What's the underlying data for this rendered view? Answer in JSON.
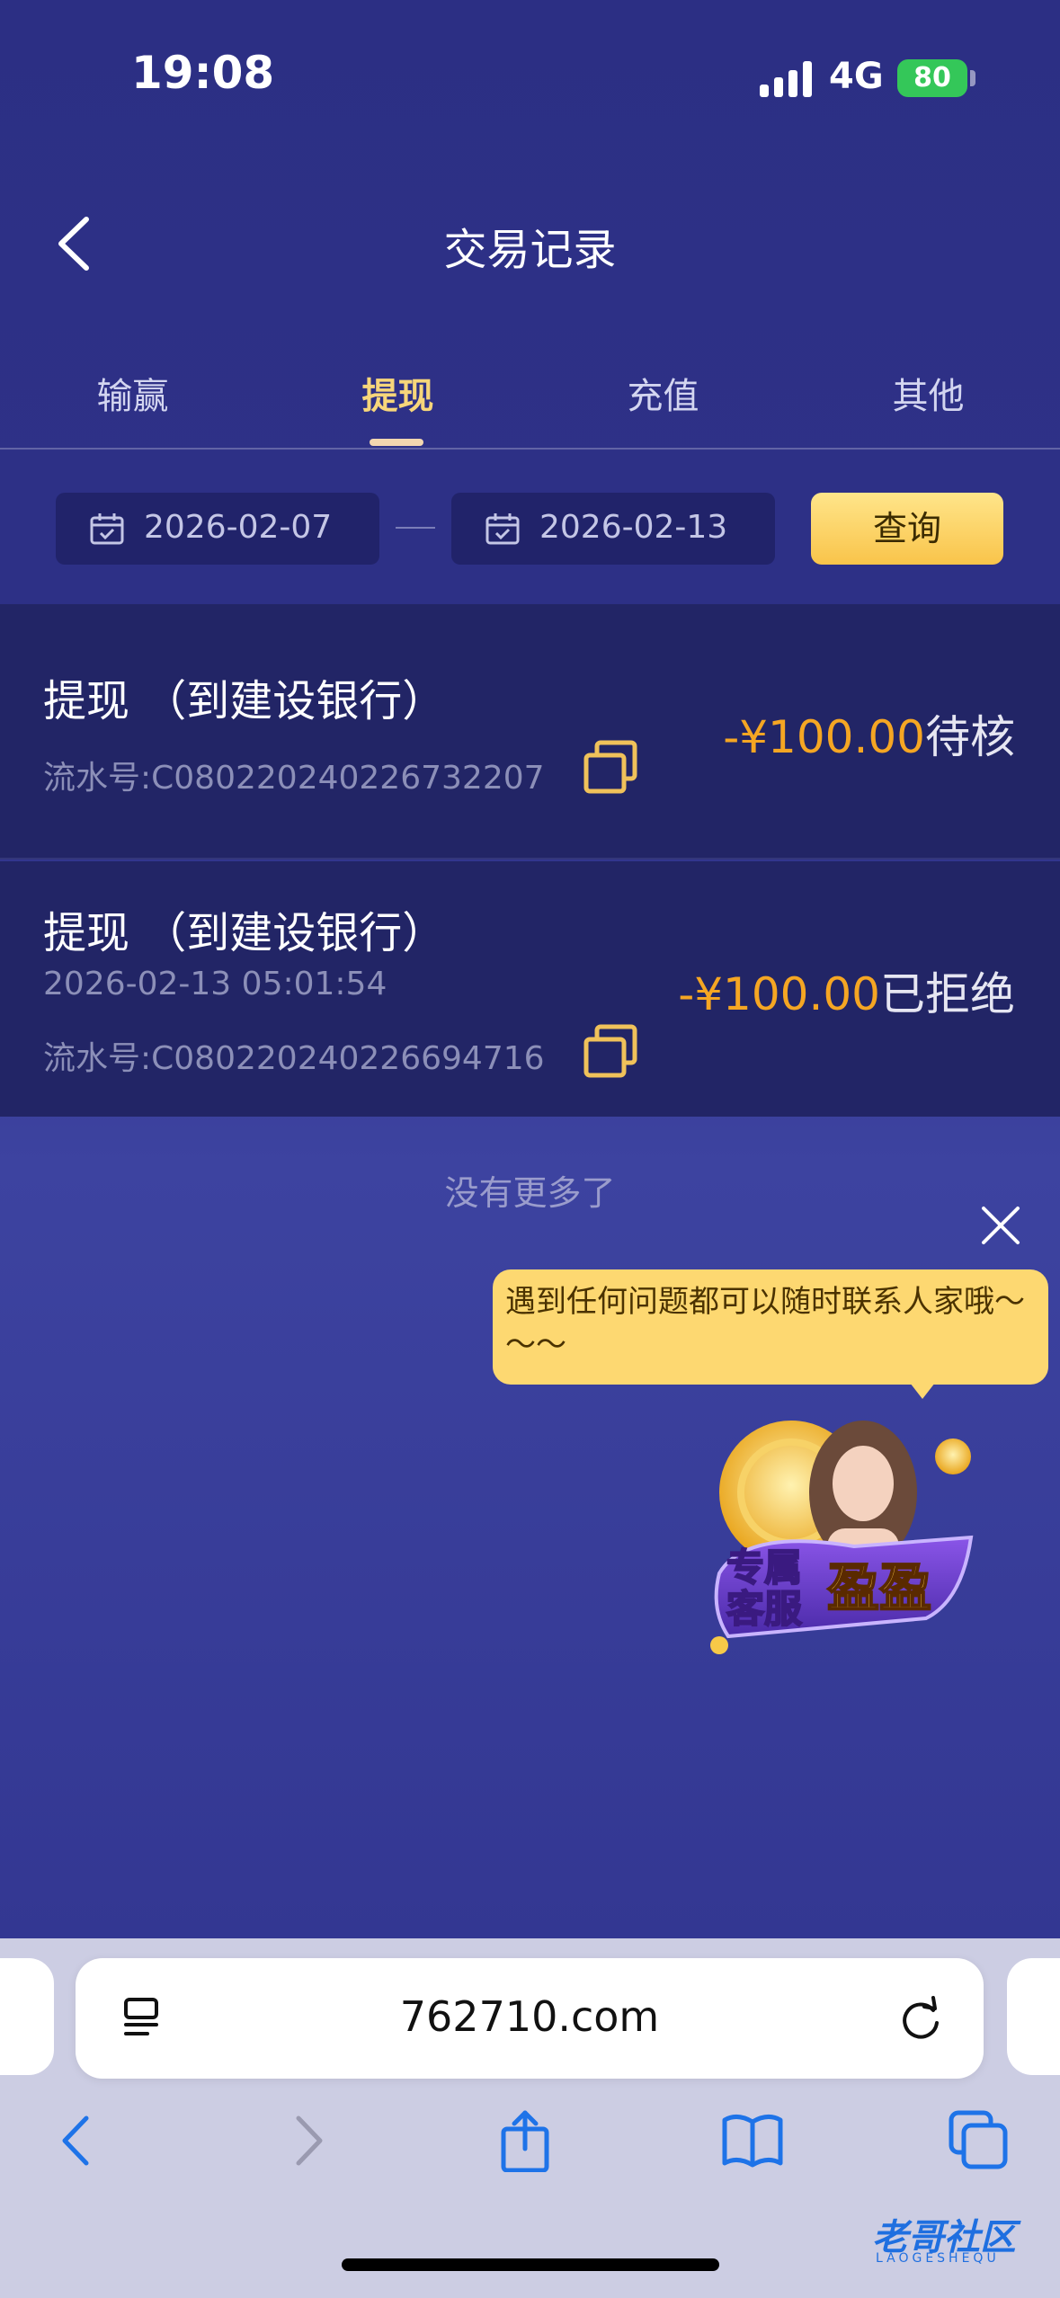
{
  "status_bar": {
    "time": "19:08",
    "network": "4G",
    "battery": "80"
  },
  "header": {
    "title": "交易记录"
  },
  "tabs": [
    {
      "label": "输赢"
    },
    {
      "label": "提现"
    },
    {
      "label": "充值"
    },
    {
      "label": "其他"
    }
  ],
  "active_tab": "提现",
  "filter": {
    "start_date": "2026-02-07",
    "end_date": "2026-02-13",
    "query_label": "查询"
  },
  "records": [
    {
      "title": "提现 （到建设银行）",
      "time": "",
      "serial": "流水号:C080220240226732207",
      "amount": "-¥100.00",
      "status": "待核"
    },
    {
      "title": "提现 （到建设银行）",
      "time": "2026-02-13 05:01:54",
      "serial": "流水号:C080220240226694716",
      "amount": "-¥100.00",
      "status": "已拒绝"
    }
  ],
  "no_more_text": "没有更多了",
  "service": {
    "bubble_text": "遇到任何问题都可以随时联系人家哦～～～",
    "badge_line1": "专属",
    "badge_line2": "客服",
    "badge_name": "盈盈"
  },
  "browser": {
    "url": "762710.com"
  },
  "watermark": {
    "text": "老哥社区",
    "sub": "LAOGESHEQU"
  },
  "colors": {
    "accent": "#f7d67a",
    "amount": "#f5a623",
    "bg": "#2c2f84",
    "record_bg": "#222566"
  }
}
